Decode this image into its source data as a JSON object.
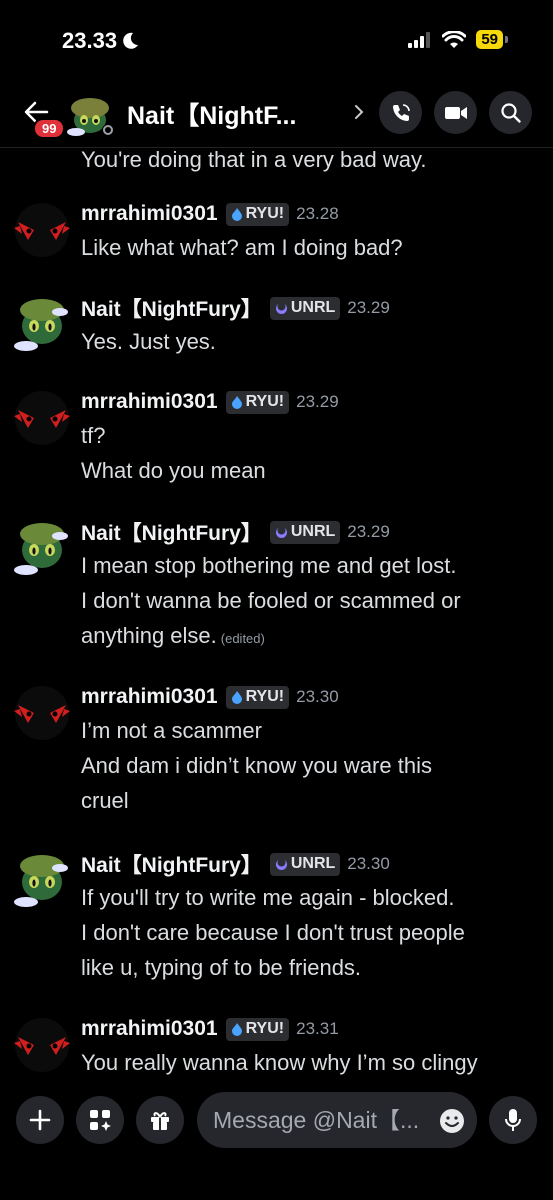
{
  "status": {
    "time": "23.33",
    "battery": "59"
  },
  "header": {
    "back_label": "Back",
    "unread_badge": "99",
    "title": "Nait【NightF..."
  },
  "top_fragment": "You're doing that in a very bad way.",
  "tags": {
    "ryu": {
      "text": "RYU!",
      "icon": "flame-icon",
      "color": "#4aa3ff"
    },
    "unrl": {
      "text": "UNRL",
      "icon": "crescent-moon-icon",
      "color": "#8a7bff"
    }
  },
  "messages": [
    {
      "author": "mrrahimi0301",
      "tag": "RYU!",
      "time": "23.28",
      "lines": [
        "Like what what?  am I doing bad?"
      ]
    },
    {
      "author": "Nait【NightFury】",
      "tag": "UNRL",
      "time": "23.29",
      "lines": [
        "Yes. Just yes."
      ]
    },
    {
      "author": "mrrahimi0301",
      "tag": "RYU!",
      "time": "23.29",
      "lines": [
        "tf?",
        "What do you mean"
      ]
    },
    {
      "author": "Nait【NightFury】",
      "tag": "UNRL",
      "time": "23.29",
      "lines": [
        "I mean stop bothering me and get lost.",
        "I don't wanna be fooled or scammed or",
        "anything else."
      ],
      "edited": "(edited)"
    },
    {
      "author": "mrrahimi0301",
      "tag": "RYU!",
      "time": "23.30",
      "lines": [
        "I’m not a scammer",
        "And dam i didn’t know you ware this",
        "cruel"
      ]
    },
    {
      "author": "Nait【NightFury】",
      "tag": "UNRL",
      "time": "23.30",
      "lines": [
        "If you'll try to write me again - blocked.",
        "I don't care because I don't trust people",
        "like u, typing of to be friends."
      ]
    },
    {
      "author": "mrrahimi0301",
      "tag": "RYU!",
      "time": "23.31",
      "lines": [
        "You really wanna know why I’m so clingy"
      ]
    }
  ],
  "composer": {
    "placeholder": "Message @Nait【..."
  },
  "colors": {
    "background": "#000000",
    "surface": "#26272c",
    "badge": "#e0313a",
    "battery": "#f5d90a",
    "timestamp": "#949ba4"
  }
}
